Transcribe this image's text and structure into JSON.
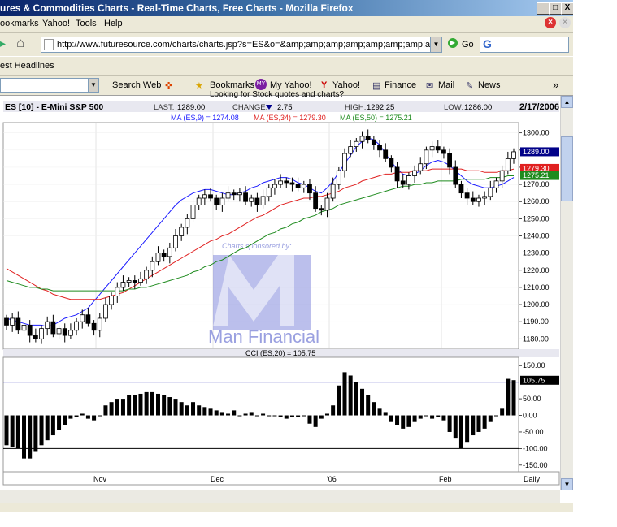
{
  "window": {
    "title": "ures & Commodities Charts - Real-Time Charts, Free Charts - Mozilla Firefox",
    "buttons": [
      "_",
      "□",
      "X"
    ]
  },
  "menu": {
    "items": [
      "ookmarks",
      "Yahoo!",
      "Tools",
      "Help"
    ]
  },
  "nav": {
    "url": "http://www.futuresource.com/charts/charts.jsp?s=ES&o=&amp;amp;amp;amp;amp;amp;amp;amp;amp;a=D6",
    "go_label": "Go",
    "search_icon": "google-icon"
  },
  "bookmarks_bar": {
    "items": [
      "est Headlines"
    ]
  },
  "yahoo_toolbar": {
    "items": [
      "Search Web",
      "Bookmarks",
      "My Yahoo!",
      "Yahoo!",
      "Finance",
      "Mail",
      "News"
    ],
    "overflow": "»"
  },
  "page_link": "Looking for Stock quotes and charts?",
  "chart_header": {
    "symbol": "ES [10] - E-Mini S&P 500",
    "last_label": "LAST:",
    "last": "1289.00",
    "change_label": "CHANGE:",
    "change": "2.75",
    "high_label": "HIGH:",
    "high": "1292.25",
    "low_label": "LOW:",
    "low": "1286.00",
    "date": "2/17/2006"
  },
  "ma_legend": {
    "ma9": "MA (ES,9) = 1274.08",
    "ma34": "MA (ES,34) = 1279.30",
    "ma50": "MA (ES,50) = 1275.21"
  },
  "colors": {
    "ma9": "#1a1aff",
    "ma34": "#e02020",
    "ma50": "#1e8b1e",
    "grid": "#c8c8c8",
    "watermark": "#9aa0e0"
  },
  "watermark": {
    "line1": "Charts sponsored by:",
    "logo_letter": "M",
    "line2": "Man Financial"
  },
  "price_axis": {
    "ticks": [
      "1300.00",
      "1290.00",
      "1280.00",
      "1270.00",
      "1260.00",
      "1250.00",
      "1240.00",
      "1230.00",
      "1220.00",
      "1210.00",
      "1200.00",
      "1190.00",
      "1180.00"
    ],
    "last_tag": "1289.00",
    "ma34_tag": "1279.30",
    "ma50_tag": "1275.21"
  },
  "cci": {
    "label": "CCI (ES,20) = 105.75",
    "ticks": [
      "150.00",
      "100.00",
      "50.00",
      "0.00",
      "-50.00",
      "-100.00",
      "-150.00"
    ],
    "last_tag": "105.75"
  },
  "x_axis": {
    "labels": [
      "Nov",
      "Dec",
      "'06",
      "Feb",
      "Daily"
    ]
  },
  "chart_data": [
    {
      "type": "candlestick",
      "title": "ES [10] - E-Mini S&P 500",
      "ylim": [
        1174,
        1306
      ],
      "series": [
        {
          "name": "MA (ES,9)",
          "values": [
            1192,
            1191,
            1190,
            1189,
            1188,
            1188,
            1188,
            1187,
            1188,
            1190,
            1192,
            1193,
            1194,
            1196,
            1198,
            1202,
            1206,
            1210,
            1214,
            1218,
            1222,
            1226,
            1230,
            1234,
            1238,
            1242,
            1246,
            1250,
            1254,
            1258,
            1261,
            1263,
            1265,
            1266,
            1267,
            1267,
            1266,
            1265,
            1264,
            1264,
            1265,
            1266,
            1268,
            1269,
            1271,
            1272,
            1273,
            1274,
            1274,
            1273,
            1271,
            1270,
            1268,
            1266,
            1265,
            1268,
            1272,
            1277,
            1282,
            1287,
            1292,
            1295,
            1297,
            1296,
            1293,
            1288,
            1283,
            1279,
            1276,
            1275,
            1276,
            1278,
            1281,
            1283,
            1284,
            1283,
            1281,
            1278,
            1275,
            1272,
            1270,
            1269,
            1268,
            1268,
            1269,
            1270,
            1272,
            1274
          ]
        },
        {
          "name": "MA (ES,34)",
          "values": [
            1221,
            1219,
            1217,
            1215,
            1213,
            1211,
            1209,
            1208,
            1206,
            1205,
            1204,
            1203,
            1203,
            1203,
            1203,
            1203,
            1203,
            1204,
            1205,
            1206,
            1207,
            1209,
            1211,
            1213,
            1215,
            1217,
            1219,
            1221,
            1223,
            1225,
            1227,
            1229,
            1231,
            1233,
            1235,
            1237,
            1238,
            1240,
            1241,
            1243,
            1245,
            1247,
            1249,
            1251,
            1252,
            1254,
            1256,
            1258,
            1259,
            1260,
            1261,
            1262,
            1262,
            1263,
            1263,
            1264,
            1265,
            1266,
            1268,
            1269,
            1270,
            1272,
            1273,
            1274,
            1275,
            1276,
            1276,
            1277,
            1277,
            1277,
            1278,
            1278,
            1278,
            1279,
            1279,
            1279,
            1279,
            1279,
            1279,
            1278,
            1278,
            1278,
            1277,
            1277,
            1277,
            1278,
            1278,
            1279
          ]
        },
        {
          "name": "MA (ES,50)",
          "values": [
            1214,
            1213,
            1212,
            1211,
            1210,
            1210,
            1209,
            1209,
            1208,
            1208,
            1208,
            1208,
            1208,
            1208,
            1208,
            1208,
            1208,
            1208,
            1208,
            1208,
            1208,
            1209,
            1209,
            1210,
            1210,
            1211,
            1212,
            1213,
            1214,
            1215,
            1216,
            1217,
            1219,
            1220,
            1222,
            1223,
            1225,
            1226,
            1228,
            1230,
            1232,
            1233,
            1235,
            1237,
            1239,
            1241,
            1242,
            1244,
            1245,
            1247,
            1248,
            1250,
            1251,
            1252,
            1254,
            1255,
            1256,
            1258,
            1259,
            1260,
            1261,
            1262,
            1263,
            1264,
            1265,
            1266,
            1267,
            1268,
            1269,
            1269,
            1270,
            1270,
            1271,
            1271,
            1272,
            1272,
            1272,
            1272,
            1273,
            1273,
            1273,
            1273,
            1273,
            1274,
            1274,
            1274,
            1275,
            1275
          ]
        },
        {
          "name": "ES",
          "values": [
            1188,
            1192,
            1185,
            1188,
            1182,
            1180,
            1186,
            1190,
            1183,
            1186,
            1182,
            1185,
            1190,
            1194,
            1189,
            1185,
            1192,
            1200,
            1205,
            1210,
            1213,
            1214,
            1213,
            1215,
            1220,
            1225,
            1230,
            1228,
            1233,
            1240,
            1245,
            1250,
            1258,
            1262,
            1264,
            1262,
            1258,
            1262,
            1265,
            1264,
            1265,
            1260,
            1262,
            1258,
            1263,
            1268,
            1270,
            1272,
            1271,
            1270,
            1268,
            1270,
            1265,
            1256,
            1255,
            1262,
            1270,
            1278,
            1288,
            1292,
            1295,
            1298,
            1296,
            1293,
            1290,
            1285,
            1280,
            1272,
            1270,
            1275,
            1278,
            1282,
            1290,
            1292,
            1290,
            1288,
            1280,
            1270,
            1265,
            1262,
            1260,
            1262,
            1263,
            1268,
            1272,
            1278,
            1285,
            1289
          ]
        }
      ]
    },
    {
      "type": "bar",
      "title": "CCI (ES,20) = 105.75",
      "ylim": [
        -170,
        175
      ],
      "values": [
        -90,
        -95,
        -100,
        -130,
        -130,
        -110,
        -90,
        -75,
        -60,
        -45,
        -30,
        -10,
        -5,
        5,
        -10,
        -15,
        0,
        30,
        40,
        50,
        50,
        60,
        60,
        65,
        70,
        70,
        65,
        60,
        55,
        50,
        40,
        30,
        40,
        30,
        25,
        20,
        15,
        10,
        5,
        15,
        0,
        5,
        10,
        0,
        5,
        0,
        0,
        -5,
        -10,
        -5,
        -5,
        0,
        -25,
        -35,
        -10,
        5,
        30,
        90,
        130,
        120,
        100,
        80,
        60,
        40,
        20,
        10,
        -20,
        -30,
        -40,
        -35,
        -20,
        -10,
        0,
        -10,
        -5,
        -15,
        -50,
        -70,
        -100,
        -80,
        -60,
        -50,
        -40,
        -20,
        0,
        20,
        110,
        106
      ]
    }
  ]
}
